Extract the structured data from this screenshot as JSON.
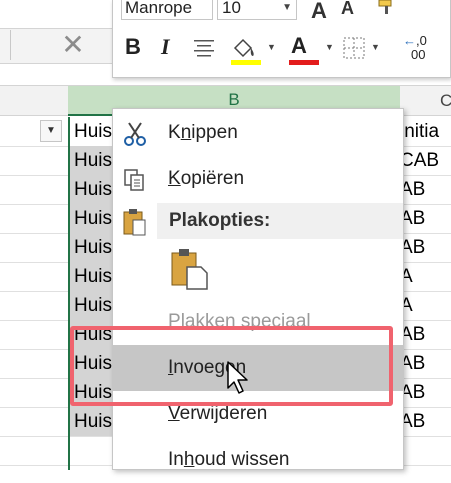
{
  "toolbar": {
    "font_name": "Manrope",
    "font_size": "10",
    "grow_font": "A",
    "shrink_font": "A",
    "bold": "B",
    "italic": "I",
    "font_color": "A",
    "decimal_increase": ",0",
    "decimal_increase2": "00",
    "fill_color": "#ffff00",
    "font_color_hex": "#e31c1c"
  },
  "formula_bar": {
    "cancel": "✕"
  },
  "column_headers": {
    "b": "B",
    "c": "C"
  },
  "cells_b": [
    "Huis",
    "Huis",
    "Huis",
    "Huis",
    "Huis",
    "Huis",
    "Huis",
    "Huis",
    "Huis",
    "Huis",
    "Huis"
  ],
  "cells_c": [
    "initia",
    "CAB",
    "AB",
    "AB",
    "AB",
    "A",
    "A",
    "AB",
    "AB",
    "AB",
    "AB"
  ],
  "context_menu": {
    "cut_pre": "K",
    "cut_key": "n",
    "cut_post": "ippen",
    "copy_key": "K",
    "copy_post": "opiëren",
    "paste_options": "Plakopties:",
    "paste_special_pre": "P",
    "paste_special_key": "l",
    "paste_special_post": "akken speciaal",
    "insert_key": "I",
    "insert_post": "nvoegen",
    "delete_key": "V",
    "delete_post": "erwijderen",
    "clear_pre": "In",
    "clear_key": "h",
    "clear_post": "oud wissen"
  },
  "colors": {
    "accent_green": "#217346",
    "annotation_red": "#f0636e",
    "hover_gray": "#c6c6c6"
  }
}
